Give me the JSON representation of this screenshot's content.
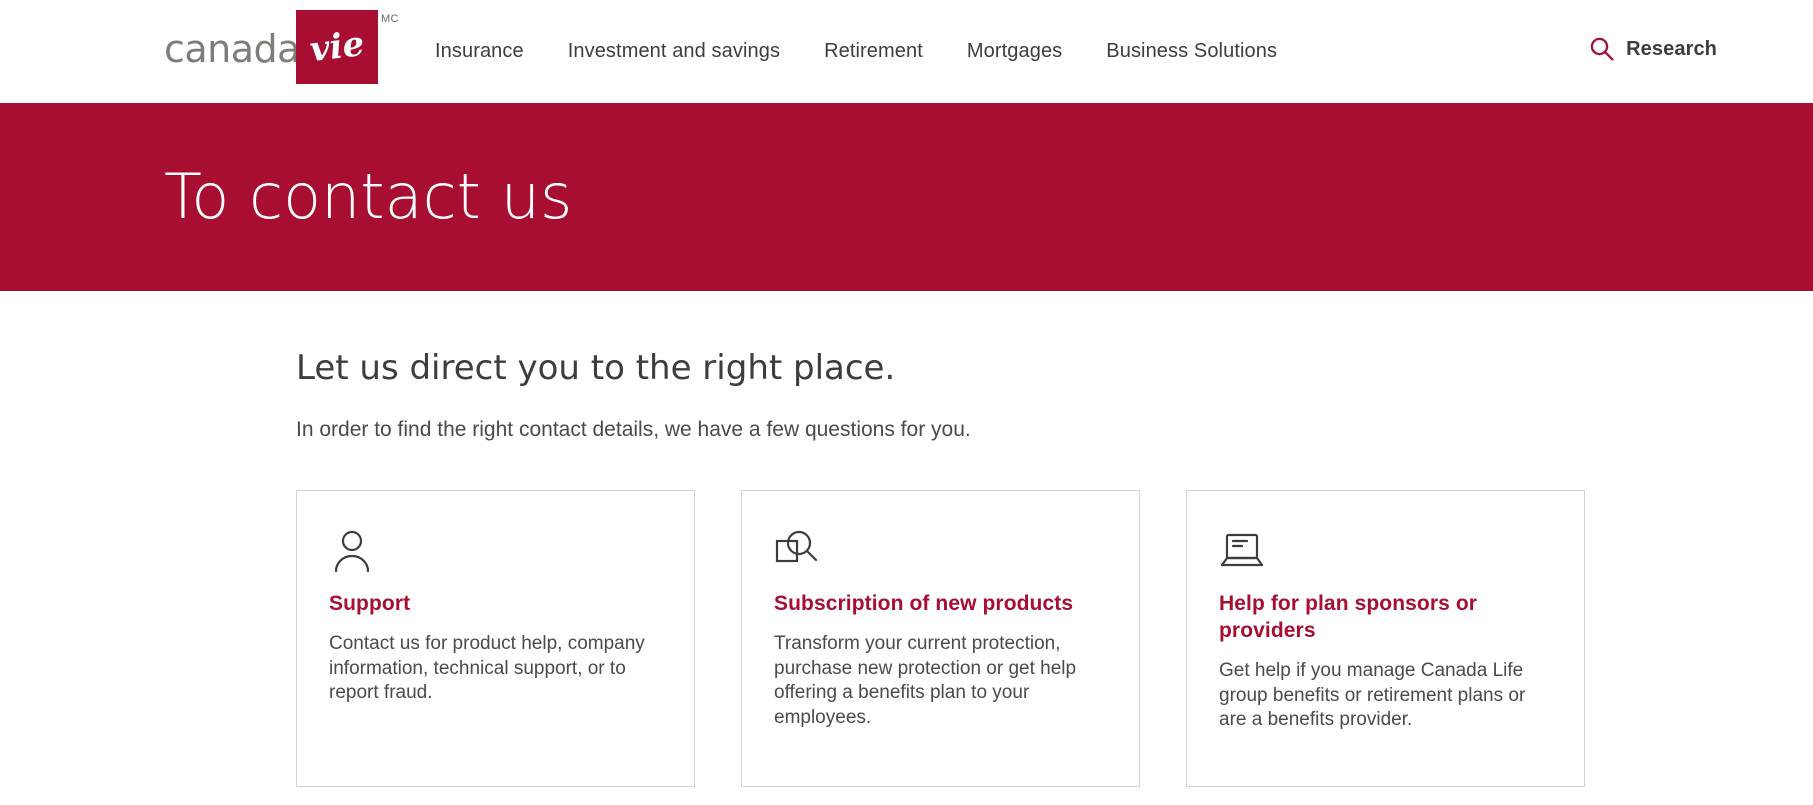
{
  "theme": {
    "brand_crimson": "#A80D32",
    "text_dark": "#3d3d3d",
    "text_body": "#4a4a4a",
    "logo_gray": "#7c7f75",
    "card_border": "#d4d4d4"
  },
  "header": {
    "logo": {
      "word": "canada",
      "mark_text": "vie",
      "trademark": "MC"
    },
    "nav": [
      {
        "label": "Insurance"
      },
      {
        "label": "Investment and savings"
      },
      {
        "label": "Retirement"
      },
      {
        "label": "Mortgages"
      },
      {
        "label": "Business Solutions"
      }
    ],
    "research": {
      "label": "Research",
      "icon": "search-icon"
    }
  },
  "hero": {
    "title": "To contact us"
  },
  "main": {
    "heading": "Let us direct you to the right place.",
    "subheading": "In order to find the right contact details, we have a few questions for you.",
    "cards": [
      {
        "icon": "person-icon",
        "title": "Support",
        "text": "Contact us for product help, company information, technical support, or to report fraud."
      },
      {
        "icon": "magnifier-document-icon",
        "title": "Subscription of new products",
        "text": "Transform your current protection, purchase new protection or get help offering a benefits plan to your employees."
      },
      {
        "icon": "laptop-icon",
        "title": "Help for plan sponsors or providers",
        "text": "Get help if you manage Canada Life group benefits or retirement plans or are a benefits provider."
      }
    ]
  }
}
